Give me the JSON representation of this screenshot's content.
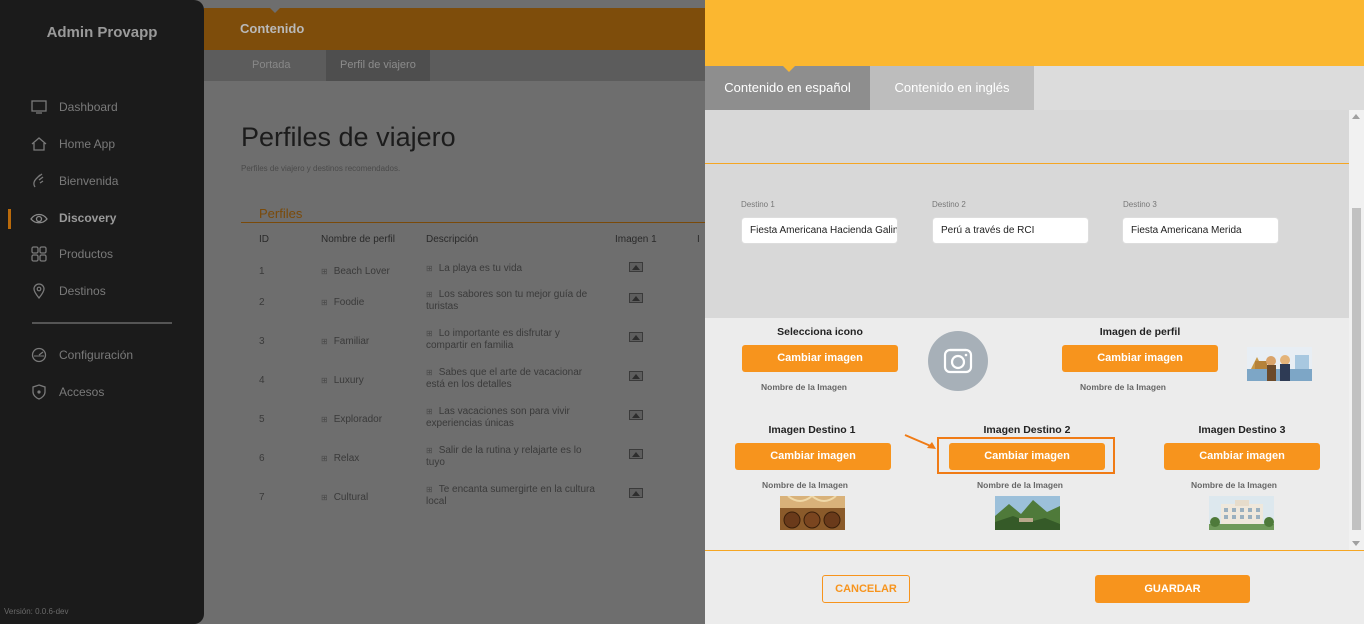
{
  "sidebar": {
    "brand": "Admin Provapp",
    "items": [
      {
        "label": "Dashboard",
        "icon": "monitor-icon"
      },
      {
        "label": "Home App",
        "icon": "home-icon"
      },
      {
        "label": "Bienvenida",
        "icon": "hand-wave-icon"
      },
      {
        "label": "Discovery",
        "icon": "eye-icon"
      },
      {
        "label": "Productos",
        "icon": "grid-icon"
      },
      {
        "label": "Destinos",
        "icon": "location-pin-icon"
      },
      {
        "label": "Configuración",
        "icon": "gauge-icon"
      },
      {
        "label": "Accesos",
        "icon": "shield-icon"
      }
    ],
    "version": "Versión: 0.0.6-dev"
  },
  "main": {
    "header_title": "Contenido",
    "subtabs": [
      "Portada",
      "Perfil de viajero"
    ],
    "page_title": "Perfiles de viajero",
    "page_subtitle": "Perfiles de viajero y destinos recomendados.",
    "section_label": "Perfiles",
    "columns": [
      "ID",
      "Nombre de perfil",
      "Descripción",
      "Imagen 1",
      "I"
    ],
    "rows": [
      {
        "id": "1",
        "name": "Beach Lover",
        "desc": "La playa es tu vida"
      },
      {
        "id": "2",
        "name": "Foodie",
        "desc": "Los sabores son tu mejor guía de turistas"
      },
      {
        "id": "3",
        "name": "Familiar",
        "desc": "Lo importante es disfrutar y compartir en familia"
      },
      {
        "id": "4",
        "name": "Luxury",
        "desc": "Sabes que el arte de vacacionar está en los detalles"
      },
      {
        "id": "5",
        "name": "Explorador",
        "desc": "Las vacaciones son para vivir experiencias únicas"
      },
      {
        "id": "6",
        "name": "Relax",
        "desc": "Salir de la rutina y relajarte es lo tuyo"
      },
      {
        "id": "7",
        "name": "Cultural",
        "desc": "Te encanta sumergirte en la cultura local"
      }
    ]
  },
  "panel": {
    "tabs": [
      "Contenido en español",
      "Contenido en inglés"
    ],
    "destinations": [
      {
        "label": "Destino 1",
        "value": "Fiesta Americana Hacienda Galindo"
      },
      {
        "label": "Destino 2",
        "value": "Perú a través de RCI"
      },
      {
        "label": "Destino 3",
        "value": "Fiesta Americana Merida"
      }
    ],
    "images": {
      "icon_title": "Selecciona icono",
      "profile_title": "Imagen de perfil",
      "dest1_title": "Imagen Destino 1",
      "dest2_title": "Imagen Destino 2",
      "dest3_title": "Imagen Destino 3",
      "change_label": "Cambiar imagen",
      "name_label": "Nombre de la Imagen"
    },
    "cancel_label": "CANCELAR",
    "save_label": "GUARDAR"
  },
  "colors": {
    "accent": "#f7941d",
    "panel_header": "#fbb730",
    "highlight": "#f07b15"
  }
}
